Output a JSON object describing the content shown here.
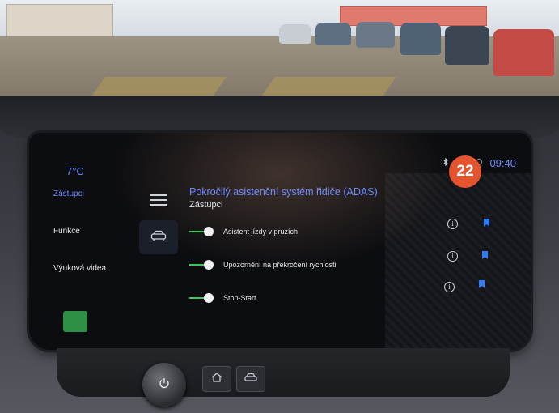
{
  "screen": {
    "temperature": "7°C",
    "time": "09:40",
    "status_icons": [
      "bluetooth-icon",
      "car-connected-icon",
      "signal-icon"
    ],
    "accent_color": "#6f8bff",
    "toggle_color": "#37c95b"
  },
  "sidebar": {
    "items": [
      {
        "label": "Zástupci",
        "active": true
      },
      {
        "label": "Funkce",
        "active": false
      },
      {
        "label": "Výuková videa",
        "active": false
      }
    ]
  },
  "main": {
    "title": "Pokročilý asistenční systém řidiče (ADAS)",
    "subtitle": "Zástupci",
    "settings": [
      {
        "label": "Asistent jízdy v pruzích",
        "enabled": true
      },
      {
        "label": "Upozornění na překročení rychlosti",
        "enabled": true
      },
      {
        "label": "Stop-Start",
        "enabled": true
      }
    ]
  },
  "overlay": {
    "badge": "22",
    "badge_color": "#e4542f"
  }
}
